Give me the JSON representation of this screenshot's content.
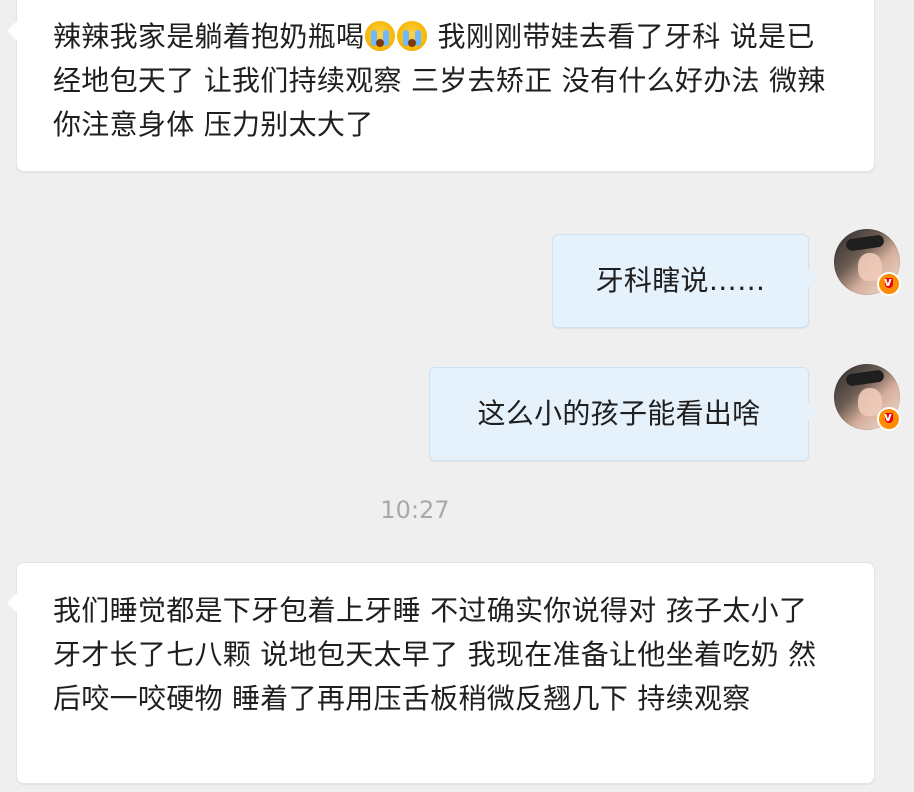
{
  "messages": [
    {
      "direction": "incoming",
      "text_before_emoji": "辣辣我家是躺着抱奶瓶喝",
      "emoji_icons": [
        "crying-face-icon",
        "crying-face-icon"
      ],
      "text_after_emoji": " 我刚刚带娃去看了牙科 说是已经地包天了 让我们持续观察 三岁去矫正 没有什么好办法 微辣你注意身体 压力别太大了"
    },
    {
      "direction": "outgoing",
      "text": "牙科瞎说……"
    },
    {
      "direction": "outgoing",
      "text": "这么小的孩子能看出啥"
    },
    {
      "direction": "incoming",
      "text": "我们睡觉都是下牙包着上牙睡 不过确实你说得对 孩子太小了  牙才长了七八颗 说地包天太早了  我现在准备让他坐着吃奶 然后咬一咬硬物 睡着了再用压舌板稍微反翘几下 持续观察"
    }
  ],
  "timestamp": "10:27",
  "colors": {
    "background": "#efefef",
    "incoming_bubble": "#ffffff",
    "outgoing_bubble": "#e5f1fb",
    "timestamp_text": "#a9a9a9",
    "badge": "#ff8b00"
  },
  "icons": {
    "avatar": "user-avatar",
    "badge": "verified-badge-icon"
  }
}
